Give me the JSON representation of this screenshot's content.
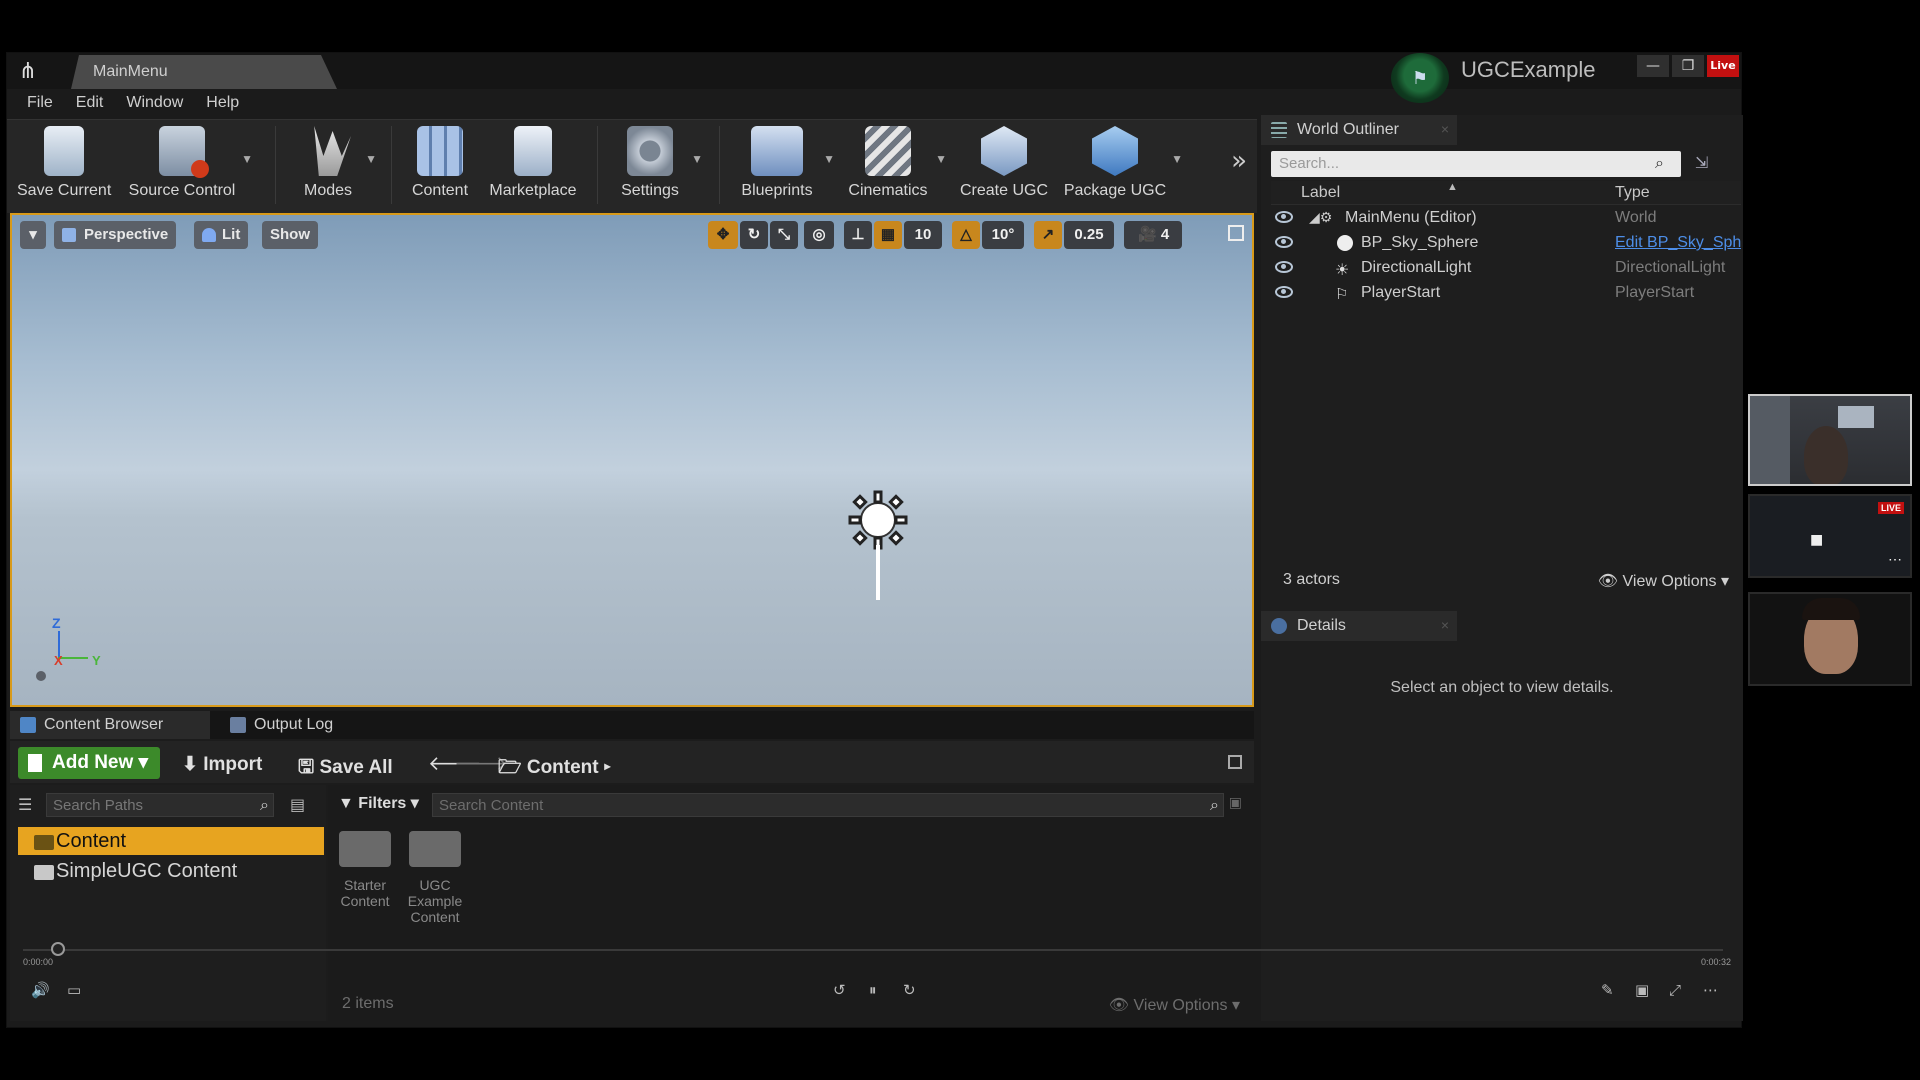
{
  "titlebar": {
    "tab": "MainMenu",
    "project_name": "UGCExample",
    "live_badge": "Live"
  },
  "menu": [
    "File",
    "Edit",
    "Window",
    "Help"
  ],
  "toolbar": {
    "items": [
      {
        "label": "Save Current",
        "icon": "save-icon"
      },
      {
        "label": "Source Control",
        "icon": "source-control-icon"
      },
      {
        "label": "Modes",
        "icon": "modes-icon"
      },
      {
        "label": "Content",
        "icon": "content-icon"
      },
      {
        "label": "Marketplace",
        "icon": "marketplace-icon"
      },
      {
        "label": "Settings",
        "icon": "settings-icon"
      },
      {
        "label": "Blueprints",
        "icon": "blueprints-icon"
      },
      {
        "label": "Cinematics",
        "icon": "cinematics-icon"
      },
      {
        "label": "Create UGC",
        "icon": "create-ugc-icon"
      },
      {
        "label": "Package UGC",
        "icon": "package-ugc-icon"
      }
    ]
  },
  "viewport": {
    "perspective": "Perspective",
    "lit": "Lit",
    "show": "Show",
    "grid_snap": "10",
    "rotation_snap": "10°",
    "scale_snap": "0.25",
    "camera_speed": "4",
    "axis_z": "Z",
    "axis_x": "X",
    "axis_y": "Y"
  },
  "outliner": {
    "title": "World Outliner",
    "search_placeholder": "Search...",
    "col_label": "Label",
    "col_type": "Type",
    "rows": [
      {
        "label": "MainMenu (Editor)",
        "type": "World"
      },
      {
        "label": "BP_Sky_Sphere",
        "type": "Edit BP_Sky_Sphere"
      },
      {
        "label": "DirectionalLight",
        "type": "DirectionalLight"
      },
      {
        "label": "PlayerStart",
        "type": "PlayerStart"
      }
    ],
    "actor_count": "3 actors",
    "view_options": "View Options"
  },
  "details": {
    "title": "Details",
    "empty_message": "Select an object to view details."
  },
  "content_browser": {
    "tab_content": "Content Browser",
    "tab_output": "Output Log",
    "add_new": "Add New",
    "import": "Import",
    "save_all": "Save All",
    "path": "Content",
    "search_paths_placeholder": "Search Paths",
    "filters": "Filters",
    "search_content_placeholder": "Search Content",
    "tree": [
      "Content",
      "SimpleUGC Content"
    ],
    "assets": [
      {
        "label": "Starter Content"
      },
      {
        "label": "UGC Example Content"
      }
    ],
    "item_count": "2 items",
    "view_options": "View Options"
  },
  "video": {
    "time_start": "0:00:00",
    "time_end": "0:00:32"
  },
  "stream": {
    "live_badge": "LIVE"
  }
}
